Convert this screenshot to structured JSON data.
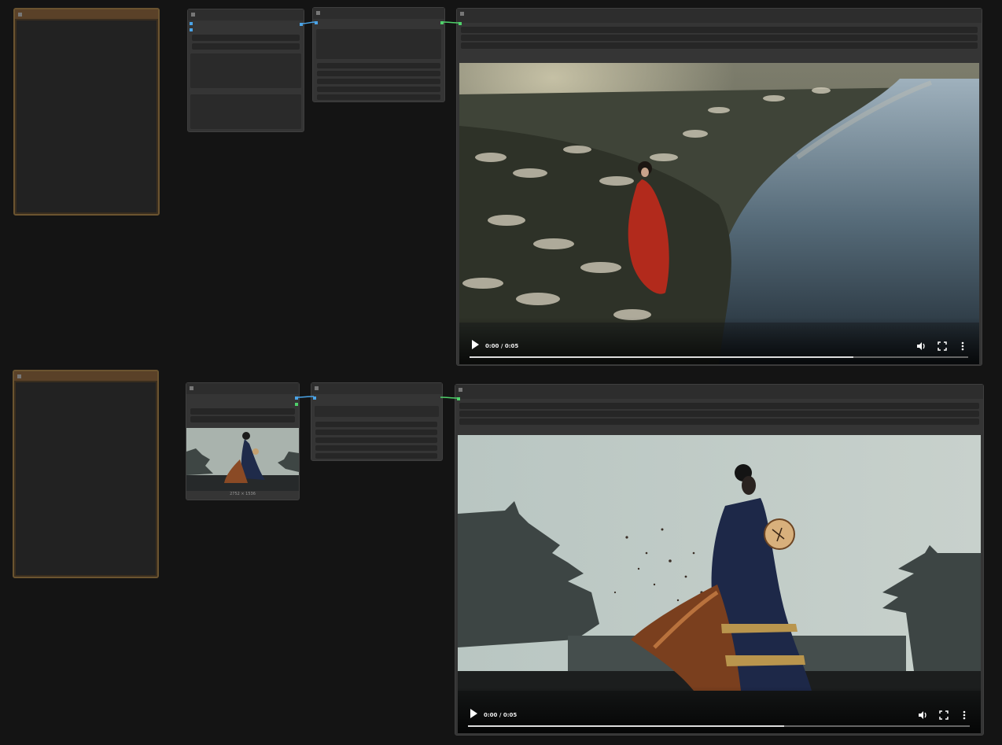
{
  "workflow_top": {
    "video": {
      "time": "0:00 / 0:05",
      "progress": 0.77
    }
  },
  "workflow_bottom": {
    "image_loader": {
      "dimensions": "2752 × 1536"
    },
    "video": {
      "time": "0:00 / 0:05",
      "progress": 0.63
    }
  },
  "colors": {
    "canvas": "#141414",
    "node": "#353535",
    "note_border": "#6b5430",
    "link_blue": "#4aa3e6",
    "link_green": "#4fd06a"
  },
  "icons": [
    "play-icon",
    "volume-icon",
    "fullscreen-icon",
    "more-options-icon"
  ]
}
